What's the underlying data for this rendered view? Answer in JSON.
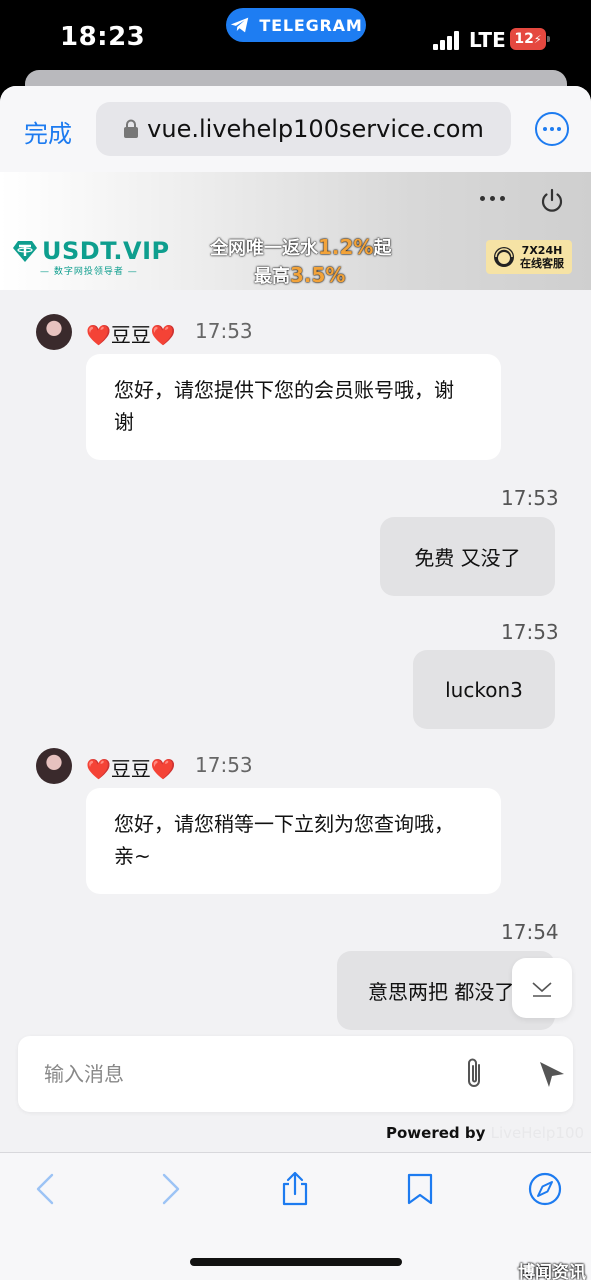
{
  "status_bar": {
    "time": "18:23",
    "app_pill": "TELEGRAM",
    "network": "LTE",
    "battery": "12"
  },
  "browser": {
    "done_label": "完成",
    "url": "vue.livehelp100service.com"
  },
  "banner": {
    "brand": "USDT.VIP",
    "brand_sub": "— 数字网投领导者 —",
    "promo_line1_pre": "全网唯一返水",
    "promo_line1_hl": "1.2%",
    "promo_line1_post": "起",
    "promo_line2_pre": "最高",
    "promo_line2_hl": "3.5%",
    "support_line1": "7X24H",
    "support_line2": "在线客服"
  },
  "chat": {
    "agent_name": "❤️豆豆❤️",
    "messages": [
      {
        "from": "agent",
        "time": "17:53",
        "text": "您好，请您提供下您的会员账号哦，谢谢"
      },
      {
        "from": "user",
        "time": "17:53",
        "text": "免费 又没了"
      },
      {
        "from": "user",
        "time": "17:53",
        "text": "luckon3"
      },
      {
        "from": "agent",
        "time": "17:53",
        "text": "您好，请您稍等一下立刻为您查询哦，亲~"
      },
      {
        "from": "user",
        "time": "17:54",
        "text": "意思两把 都没了"
      }
    ]
  },
  "composer": {
    "placeholder": "输入消息",
    "powered_by": "Powered by",
    "powered_brand": "LiveHelp100"
  },
  "watermark": "博闻资讯",
  "colors": {
    "accent": "#1d7bf0",
    "telegram": "#1e7df2",
    "battery": "#e5483f",
    "brand": "#0e9e8e"
  }
}
